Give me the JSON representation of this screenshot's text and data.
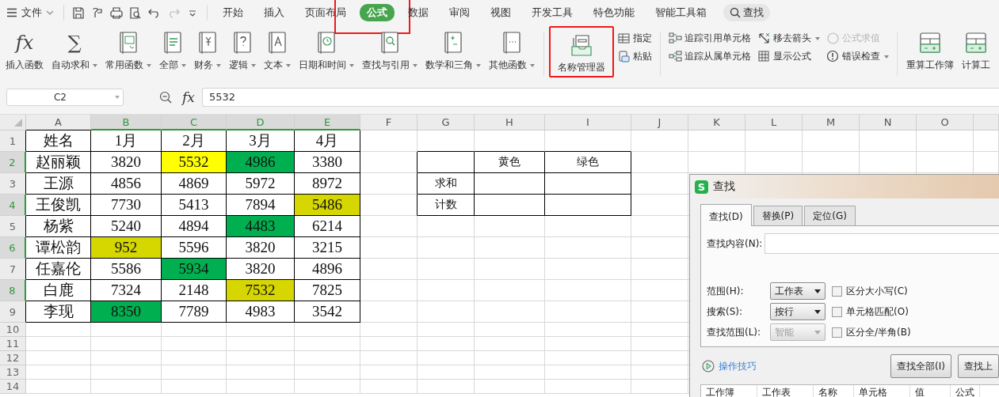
{
  "menu_bar": {
    "menu_label": "文件",
    "tabs": [
      {
        "label": "开始",
        "selected": false,
        "annotated": false
      },
      {
        "label": "插入",
        "selected": false,
        "annotated": false
      },
      {
        "label": "页面布局",
        "selected": false,
        "annotated": false
      },
      {
        "label": "公式",
        "selected": true,
        "annotated": true
      },
      {
        "label": "数据",
        "selected": false,
        "annotated": false
      },
      {
        "label": "审阅",
        "selected": false,
        "annotated": false
      },
      {
        "label": "视图",
        "selected": false,
        "annotated": false
      },
      {
        "label": "开发工具",
        "selected": false,
        "annotated": false
      },
      {
        "label": "特色功能",
        "selected": false,
        "annotated": false
      },
      {
        "label": "智能工具箱",
        "selected": false,
        "annotated": false
      }
    ],
    "search_label": "查找"
  },
  "ribbon": {
    "items": [
      {
        "kind": "large",
        "label": "插入函数",
        "glyph": "fx",
        "dropdown": false,
        "annotated": false
      },
      {
        "kind": "large",
        "label": "自动求和",
        "glyph": "∑",
        "dropdown": true,
        "annotated": false
      },
      {
        "kind": "large",
        "label": "常用函数",
        "dropdown": true,
        "annotated": false
      },
      {
        "kind": "large",
        "label": "全部",
        "dropdown": true,
        "annotated": false
      },
      {
        "kind": "large",
        "label": "财务",
        "dropdown": true,
        "annotated": false
      },
      {
        "kind": "large",
        "label": "逻辑",
        "dropdown": true,
        "annotated": false
      },
      {
        "kind": "large",
        "label": "文本",
        "dropdown": true,
        "annotated": false
      },
      {
        "kind": "large",
        "label": "日期和时间",
        "dropdown": true,
        "annotated": false
      },
      {
        "kind": "large",
        "label": "查找与引用",
        "dropdown": true,
        "annotated": false
      },
      {
        "kind": "large",
        "label": "数学和三角",
        "dropdown": true,
        "annotated": false
      },
      {
        "kind": "large",
        "label": "其他函数",
        "dropdown": true,
        "annotated": false
      },
      {
        "kind": "separator"
      },
      {
        "kind": "large",
        "label": "名称管理器",
        "dropdown": false,
        "annotated": true
      },
      {
        "kind": "stack",
        "items": [
          {
            "label": "指定",
            "dropdown": false,
            "disabled": false
          },
          {
            "label": "粘贴",
            "dropdown": false,
            "disabled": false
          }
        ]
      },
      {
        "kind": "separator"
      },
      {
        "kind": "stack",
        "items": [
          {
            "label": "追踪引用单元格",
            "dropdown": false,
            "disabled": false
          },
          {
            "label": "追踪从属单元格",
            "dropdown": false,
            "disabled": false
          }
        ]
      },
      {
        "kind": "stack",
        "items": [
          {
            "label": "移去箭头",
            "dropdown": true,
            "disabled": false
          },
          {
            "label": "显示公式",
            "dropdown": false,
            "disabled": false
          }
        ]
      },
      {
        "kind": "stack",
        "items": [
          {
            "label": "公式求值",
            "dropdown": false,
            "disabled": true
          },
          {
            "label": "错误检查",
            "dropdown": true,
            "disabled": false
          }
        ]
      },
      {
        "kind": "separator"
      },
      {
        "kind": "large",
        "label": "重算工作簿",
        "dropdown": false,
        "annotated": false
      },
      {
        "kind": "large",
        "label": "计算工",
        "dropdown": false,
        "annotated": false
      }
    ]
  },
  "formula_bar": {
    "name_box": "C2",
    "fx_label": "fx",
    "value": "5532"
  },
  "sheet": {
    "columns": [
      {
        "label": "A",
        "selected": false
      },
      {
        "label": "B",
        "selected": true
      },
      {
        "label": "C",
        "selected": true
      },
      {
        "label": "D",
        "selected": true
      },
      {
        "label": "E",
        "selected": true
      },
      {
        "label": "F",
        "selected": false
      },
      {
        "label": "G",
        "selected": false
      },
      {
        "label": "H",
        "selected": false
      },
      {
        "label": "I",
        "selected": false
      },
      {
        "label": "J",
        "selected": false
      },
      {
        "label": "K",
        "selected": false
      },
      {
        "label": "L",
        "selected": false
      },
      {
        "label": "M",
        "selected": false
      },
      {
        "label": "N",
        "selected": false
      },
      {
        "label": "O",
        "selected": false
      }
    ],
    "rows": [
      {
        "label": "1",
        "selected": false
      },
      {
        "label": "2",
        "selected": true
      },
      {
        "label": "3",
        "selected": false
      },
      {
        "label": "4",
        "selected": true
      },
      {
        "label": "5",
        "selected": false
      },
      {
        "label": "6",
        "selected": true
      },
      {
        "label": "7",
        "selected": false
      },
      {
        "label": "8",
        "selected": true
      },
      {
        "label": "9",
        "selected": false
      },
      {
        "label": "10",
        "selected": false
      },
      {
        "label": "11",
        "selected": false
      },
      {
        "label": "12",
        "selected": false
      },
      {
        "label": "13",
        "selected": false
      },
      {
        "label": "14",
        "selected": false
      }
    ],
    "data_table": {
      "columns": [
        "姓名",
        "1月",
        "2月",
        "3月",
        "4月"
      ],
      "rows": [
        {
          "cells": [
            {
              "text": "赵丽颖"
            },
            {
              "text": "3820"
            },
            {
              "text": "5532",
              "color": "#ffff00"
            },
            {
              "text": "4986",
              "color": "#00b050"
            },
            {
              "text": "3380"
            }
          ]
        },
        {
          "cells": [
            {
              "text": "王源"
            },
            {
              "text": "4856"
            },
            {
              "text": "4869"
            },
            {
              "text": "5972"
            },
            {
              "text": "8972"
            }
          ]
        },
        {
          "cells": [
            {
              "text": "王俊凯"
            },
            {
              "text": "7730"
            },
            {
              "text": "5413"
            },
            {
              "text": "7894"
            },
            {
              "text": "5486",
              "color": "#d6d600"
            }
          ]
        },
        {
          "cells": [
            {
              "text": "杨紫"
            },
            {
              "text": "5240"
            },
            {
              "text": "4894"
            },
            {
              "text": "4483",
              "color": "#00b050"
            },
            {
              "text": "6214"
            }
          ]
        },
        {
          "cells": [
            {
              "text": "谭松韵"
            },
            {
              "text": "952",
              "color": "#d6d600"
            },
            {
              "text": "5596"
            },
            {
              "text": "3820"
            },
            {
              "text": "3215"
            }
          ]
        },
        {
          "cells": [
            {
              "text": "任嘉伦"
            },
            {
              "text": "5586"
            },
            {
              "text": "5934",
              "color": "#00b050"
            },
            {
              "text": "3820"
            },
            {
              "text": "4896"
            }
          ]
        },
        {
          "cells": [
            {
              "text": "白鹿"
            },
            {
              "text": "7324"
            },
            {
              "text": "2148"
            },
            {
              "text": "7532",
              "color": "#d6d600"
            },
            {
              "text": "7825"
            }
          ]
        },
        {
          "cells": [
            {
              "text": "李现"
            },
            {
              "text": "8350",
              "color": "#00b050"
            },
            {
              "text": "7789"
            },
            {
              "text": "4983"
            },
            {
              "text": "3542"
            }
          ]
        }
      ]
    },
    "summary_table": {
      "columns": [
        "黄色",
        "绿色"
      ],
      "rows": [
        "求和",
        "计数"
      ]
    }
  },
  "find_dialog": {
    "logo": "S",
    "title": "查找",
    "tabs": [
      {
        "label": "查找(D)",
        "selected": true
      },
      {
        "label": "替换(P)",
        "selected": false
      },
      {
        "label": "定位(G)",
        "selected": false
      }
    ],
    "find_label": "查找内容(N):",
    "options": [
      {
        "label": "范围(H):",
        "value": "工作表",
        "disabled": false,
        "checkbox": {
          "label": "区分大小写(C)",
          "checked": false
        }
      },
      {
        "label": "搜索(S):",
        "value": "按行",
        "disabled": false,
        "checkbox": {
          "label": "单元格匹配(O)",
          "checked": false
        }
      },
      {
        "label": "查找范围(L):",
        "value": "智能",
        "disabled": true,
        "checkbox": {
          "label": "区分全/半角(B)",
          "checked": false
        }
      }
    ],
    "tips_link": "操作技巧",
    "buttons": [
      "查找全部(I)",
      "查找上"
    ],
    "result_columns": [
      "工作簿",
      "工作表",
      "名称",
      "单元格",
      "值",
      "公式"
    ]
  }
}
